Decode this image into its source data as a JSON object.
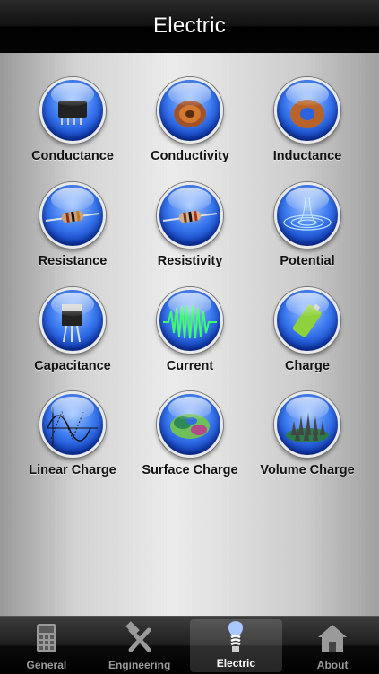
{
  "header": {
    "title": "Electric"
  },
  "grid": {
    "items": [
      {
        "label": "Conductance",
        "icon": "chip-icon"
      },
      {
        "label": "Conductivity",
        "icon": "copper-coil-icon"
      },
      {
        "label": "Inductance",
        "icon": "toroid-icon"
      },
      {
        "label": "Resistance",
        "icon": "resistor-icon"
      },
      {
        "label": "Resistivity",
        "icon": "resistor-icon"
      },
      {
        "label": "Potential",
        "icon": "potential-well-icon"
      },
      {
        "label": "Capacitance",
        "icon": "transistor-icon"
      },
      {
        "label": "Current",
        "icon": "waveform-icon"
      },
      {
        "label": "Charge",
        "icon": "battery-icon"
      },
      {
        "label": "Linear Charge",
        "icon": "sine-wave-icon"
      },
      {
        "label": "Surface Charge",
        "icon": "surface-blob-icon"
      },
      {
        "label": "Volume Charge",
        "icon": "spikes-icon"
      }
    ]
  },
  "tabbar": {
    "tabs": [
      {
        "label": "General",
        "icon": "calculator-icon",
        "active": false
      },
      {
        "label": "Engineering",
        "icon": "tools-icon",
        "active": false
      },
      {
        "label": "Electric",
        "icon": "lightbulb-icon",
        "active": true
      },
      {
        "label": "About",
        "icon": "house-icon",
        "active": false
      }
    ]
  },
  "colors": {
    "bubble": "#2a62e0",
    "active_tab": "#ffffff",
    "inactive_tab": "#9a9a9a"
  }
}
